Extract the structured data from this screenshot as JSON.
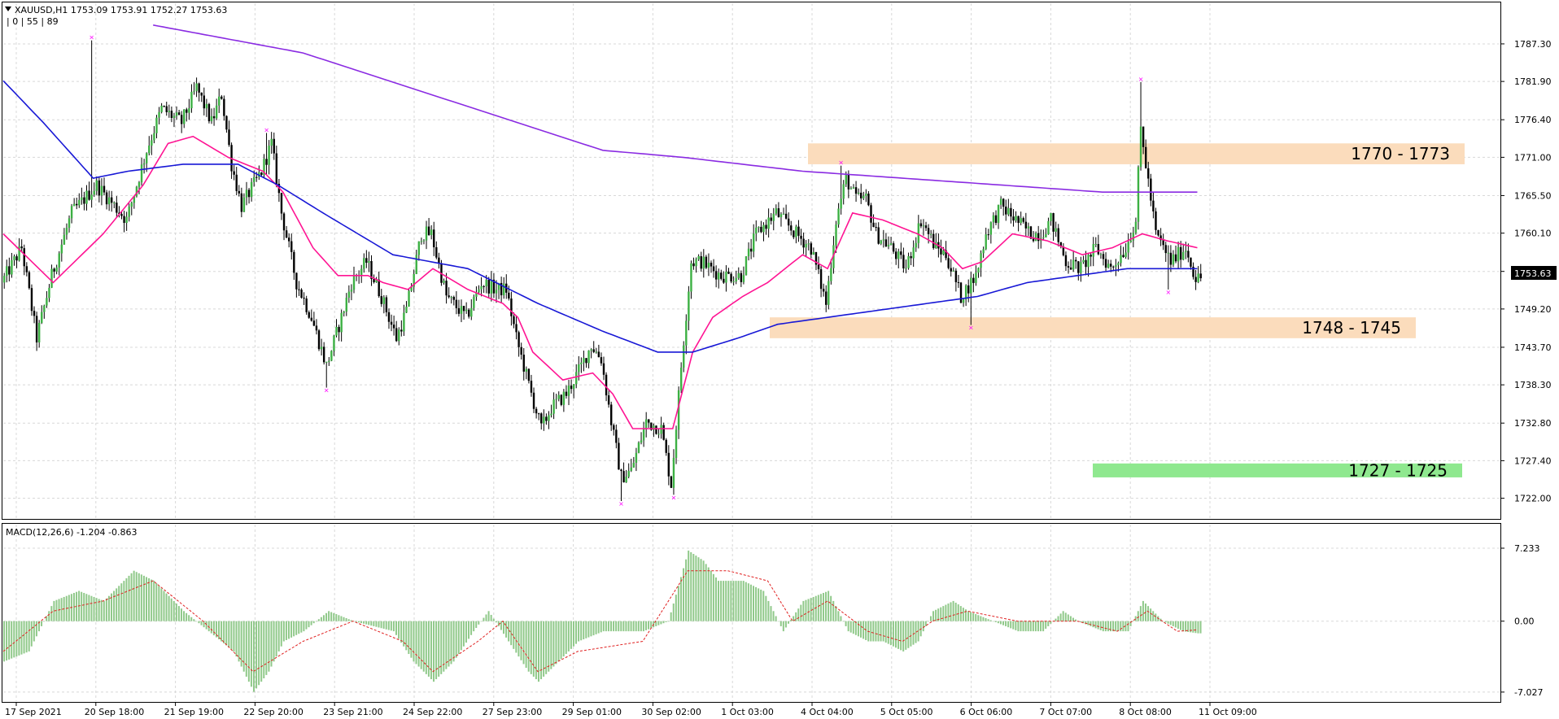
{
  "header": {
    "symbol_line": "XAUUSD,H1  1753.09 1753.91 1752.27 1753.63",
    "ind_line": "| 0 | 55 | 89"
  },
  "macd_header": "MACD(12,26,6) -1.204 -0.863",
  "current_price": "1753.63",
  "chart_data": [
    {
      "type": "candlestick",
      "symbol": "XAUUSD",
      "timeframe": "H1",
      "ohlc_last": {
        "open": 1753.09,
        "high": 1753.91,
        "low": 1752.27,
        "close": 1753.63
      },
      "y_ticks": [
        "1787.30",
        "1781.90",
        "1776.40",
        "1771.00",
        "1765.50",
        "1760.10",
        "1754.60",
        "1749.20",
        "1743.70",
        "1738.30",
        "1732.80",
        "1727.40",
        "1722.00"
      ],
      "ylim": [
        1720.9,
        1790.8
      ],
      "x_ticks": [
        "17 Sep 2021",
        "20 Sep 18:00",
        "21 Sep 19:00",
        "22 Sep 20:00",
        "23 Sep 21:00",
        "24 Sep 22:00",
        "27 Sep 23:00",
        "29 Sep 01:00",
        "30 Sep 02:00",
        "1 Oct 03:00",
        "4 Oct 04:00",
        "5 Oct 05:00",
        "6 Oct 06:00",
        "7 Oct 07:00",
        "8 Oct 08:00",
        "11 Oct 09:00"
      ],
      "price_path": [
        [
          0,
          1753
        ],
        [
          8,
          1758
        ],
        [
          14,
          1745
        ],
        [
          20,
          1754
        ],
        [
          28,
          1763
        ],
        [
          38,
          1767
        ],
        [
          50,
          1762
        ],
        [
          58,
          1772
        ],
        [
          64,
          1778
        ],
        [
          72,
          1776
        ],
        [
          78,
          1781
        ],
        [
          84,
          1776
        ],
        [
          88,
          1780
        ],
        [
          92,
          1770
        ],
        [
          96,
          1764
        ],
        [
          104,
          1769
        ],
        [
          108,
          1773
        ],
        [
          112,
          1763
        ],
        [
          118,
          1753
        ],
        [
          124,
          1748
        ],
        [
          130,
          1741
        ],
        [
          136,
          1748
        ],
        [
          140,
          1753
        ],
        [
          146,
          1756
        ],
        [
          152,
          1751
        ],
        [
          158,
          1745
        ],
        [
          162,
          1749
        ],
        [
          168,
          1760
        ],
        [
          172,
          1760
        ],
        [
          178,
          1751
        ],
        [
          186,
          1748
        ],
        [
          192,
          1753
        ],
        [
          198,
          1752
        ],
        [
          202,
          1752
        ],
        [
          206,
          1745
        ],
        [
          212,
          1737
        ],
        [
          216,
          1732
        ],
        [
          220,
          1735
        ],
        [
          226,
          1737
        ],
        [
          232,
          1741
        ],
        [
          236,
          1744
        ],
        [
          240,
          1742
        ],
        [
          244,
          1733
        ],
        [
          248,
          1725
        ],
        [
          252,
          1726
        ],
        [
          258,
          1733
        ],
        [
          264,
          1732
        ],
        [
          268,
          1724
        ],
        [
          272,
          1741
        ],
        [
          276,
          1756
        ],
        [
          280,
          1756
        ],
        [
          288,
          1754
        ],
        [
          296,
          1754
        ],
        [
          302,
          1760
        ],
        [
          310,
          1763
        ],
        [
          318,
          1760
        ],
        [
          324,
          1758
        ],
        [
          330,
          1750
        ],
        [
          334,
          1762
        ],
        [
          338,
          1768
        ],
        [
          342,
          1765
        ],
        [
          346,
          1765
        ],
        [
          350,
          1760
        ],
        [
          356,
          1758
        ],
        [
          362,
          1755
        ],
        [
          368,
          1762
        ],
        [
          374,
          1758
        ],
        [
          378,
          1757
        ],
        [
          384,
          1751
        ],
        [
          390,
          1754
        ],
        [
          394,
          1760
        ],
        [
          400,
          1764
        ],
        [
          406,
          1762
        ],
        [
          412,
          1760
        ],
        [
          416,
          1760
        ],
        [
          420,
          1762
        ],
        [
          426,
          1756
        ],
        [
          432,
          1755
        ],
        [
          438,
          1758
        ],
        [
          444,
          1755
        ],
        [
          450,
          1758
        ],
        [
          454,
          1762
        ],
        [
          456,
          1775
        ],
        [
          458,
          1770
        ],
        [
          462,
          1760
        ],
        [
          468,
          1756
        ],
        [
          474,
          1758
        ],
        [
          478,
          1753.6
        ]
      ],
      "extremes": [
        {
          "x": 35,
          "high": 1787.8
        },
        {
          "x": 105,
          "high": 1774.5
        },
        {
          "x": 129,
          "low": 1737.9
        },
        {
          "x": 247,
          "low": 1721.6
        },
        {
          "x": 268,
          "low": 1722.5
        },
        {
          "x": 335,
          "high": 1769.8
        },
        {
          "x": 387,
          "low": 1746.9
        },
        {
          "x": 455,
          "high": 1781.8
        },
        {
          "x": 466,
          "low": 1752.0
        }
      ],
      "bar_count": 480,
      "zones": [
        {
          "label": "1770 - 1773",
          "from": 1770,
          "to": 1773,
          "color": "#fbdcbc"
        },
        {
          "label": "1748 - 1745",
          "from": 1745,
          "to": 1748,
          "color": "#fbdcbc"
        },
        {
          "label": "1727 - 1725",
          "from": 1725,
          "to": 1727,
          "color": "#8fe88f"
        }
      ],
      "series": [
        {
          "name": "MA 0",
          "color": "#ff1493",
          "values": [
            [
              0,
              1760
            ],
            [
              20,
              1753
            ],
            [
              40,
              1760
            ],
            [
              56,
              1767
            ],
            [
              66,
              1773
            ],
            [
              76,
              1774
            ],
            [
              90,
              1771
            ],
            [
              104,
              1769
            ],
            [
              112,
              1766
            ],
            [
              124,
              1758
            ],
            [
              134,
              1754
            ],
            [
              146,
              1754
            ],
            [
              152,
              1753
            ],
            [
              162,
              1752
            ],
            [
              172,
              1755
            ],
            [
              186,
              1752
            ],
            [
              200,
              1750
            ],
            [
              206,
              1748
            ],
            [
              212,
              1743
            ],
            [
              224,
              1739
            ],
            [
              236,
              1740
            ],
            [
              244,
              1737
            ],
            [
              252,
              1732
            ],
            [
              268,
              1732
            ],
            [
              276,
              1743
            ],
            [
              284,
              1748
            ],
            [
              296,
              1751
            ],
            [
              306,
              1753
            ],
            [
              320,
              1757
            ],
            [
              330,
              1755
            ],
            [
              340,
              1763
            ],
            [
              352,
              1762
            ],
            [
              366,
              1760
            ],
            [
              376,
              1758
            ],
            [
              384,
              1755
            ],
            [
              392,
              1756
            ],
            [
              404,
              1760
            ],
            [
              418,
              1759
            ],
            [
              432,
              1757
            ],
            [
              444,
              1758
            ],
            [
              456,
              1760
            ],
            [
              466,
              1759
            ],
            [
              478,
              1758
            ]
          ]
        },
        {
          "name": "MA 55",
          "color": "#1818d6",
          "values": [
            [
              0,
              1782
            ],
            [
              16,
              1776
            ],
            [
              36,
              1768
            ],
            [
              50,
              1769
            ],
            [
              72,
              1770
            ],
            [
              94,
              1770
            ],
            [
              110,
              1767
            ],
            [
              128,
              1763
            ],
            [
              156,
              1757
            ],
            [
              186,
              1755
            ],
            [
              214,
              1750
            ],
            [
              240,
              1746
            ],
            [
              262,
              1743
            ],
            [
              276,
              1743
            ],
            [
              294,
              1745
            ],
            [
              310,
              1747
            ],
            [
              330,
              1748
            ],
            [
              350,
              1749
            ],
            [
              370,
              1750
            ],
            [
              390,
              1751
            ],
            [
              410,
              1753
            ],
            [
              430,
              1754
            ],
            [
              450,
              1755
            ],
            [
              465,
              1755
            ],
            [
              478,
              1755
            ]
          ]
        },
        {
          "name": "MA 89",
          "color": "#8a2be2",
          "values": [
            [
              60,
              1790
            ],
            [
              120,
              1786
            ],
            [
              180,
              1779
            ],
            [
              240,
              1772
            ],
            [
              272,
              1771
            ],
            [
              320,
              1769
            ],
            [
              360,
              1768
            ],
            [
              400,
              1767
            ],
            [
              440,
              1766
            ],
            [
              478,
              1766
            ]
          ]
        }
      ]
    },
    {
      "type": "histogram",
      "name": "MACD(12,26,6)",
      "value_label": "-1.204",
      "signal_label": "-0.863",
      "y_ticks": [
        "7.233",
        "0.00",
        "-7.027"
      ],
      "ylim": [
        -7.6,
        8.2
      ],
      "bar_color": "#90c98a",
      "signal_color": "#e02020",
      "macd_path": [
        [
          0,
          -4
        ],
        [
          10,
          -3
        ],
        [
          20,
          2
        ],
        [
          30,
          3
        ],
        [
          40,
          2
        ],
        [
          52,
          5
        ],
        [
          60,
          4
        ],
        [
          72,
          1
        ],
        [
          82,
          -1
        ],
        [
          92,
          -3
        ],
        [
          100,
          -7
        ],
        [
          106,
          -5
        ],
        [
          112,
          -2
        ],
        [
          120,
          -1
        ],
        [
          130,
          1
        ],
        [
          140,
          0
        ],
        [
          156,
          -1
        ],
        [
          164,
          -4
        ],
        [
          172,
          -6
        ],
        [
          180,
          -4
        ],
        [
          188,
          -1
        ],
        [
          194,
          1
        ],
        [
          202,
          -2
        ],
        [
          210,
          -5
        ],
        [
          214,
          -6
        ],
        [
          222,
          -4
        ],
        [
          230,
          -2
        ],
        [
          240,
          -1
        ],
        [
          256,
          -1
        ],
        [
          266,
          0
        ],
        [
          274,
          7
        ],
        [
          280,
          6
        ],
        [
          286,
          4
        ],
        [
          296,
          4
        ],
        [
          304,
          3
        ],
        [
          312,
          -1
        ],
        [
          320,
          2
        ],
        [
          330,
          3
        ],
        [
          338,
          -1
        ],
        [
          346,
          -2
        ],
        [
          352,
          -2
        ],
        [
          360,
          -3
        ],
        [
          366,
          -2
        ],
        [
          372,
          1
        ],
        [
          380,
          2
        ],
        [
          386,
          1
        ],
        [
          396,
          0
        ],
        [
          406,
          -1
        ],
        [
          416,
          -1
        ],
        [
          424,
          1
        ],
        [
          430,
          0
        ],
        [
          440,
          -1
        ],
        [
          446,
          -1
        ],
        [
          450,
          -1
        ],
        [
          456,
          2
        ],
        [
          464,
          0
        ],
        [
          472,
          -1
        ],
        [
          478,
          -1.204
        ]
      ],
      "signal_path": [
        [
          0,
          -3
        ],
        [
          20,
          1
        ],
        [
          40,
          2
        ],
        [
          60,
          4
        ],
        [
          80,
          0
        ],
        [
          100,
          -5
        ],
        [
          120,
          -2
        ],
        [
          140,
          0
        ],
        [
          160,
          -2
        ],
        [
          172,
          -5
        ],
        [
          190,
          -2
        ],
        [
          200,
          0
        ],
        [
          214,
          -5
        ],
        [
          230,
          -3
        ],
        [
          256,
          -2
        ],
        [
          274,
          5
        ],
        [
          290,
          5
        ],
        [
          306,
          4
        ],
        [
          316,
          0
        ],
        [
          330,
          2
        ],
        [
          346,
          -1
        ],
        [
          360,
          -2
        ],
        [
          372,
          0
        ],
        [
          386,
          1
        ],
        [
          406,
          0
        ],
        [
          430,
          0
        ],
        [
          446,
          -1
        ],
        [
          458,
          1
        ],
        [
          470,
          -1
        ],
        [
          478,
          -0.863
        ]
      ]
    }
  ]
}
